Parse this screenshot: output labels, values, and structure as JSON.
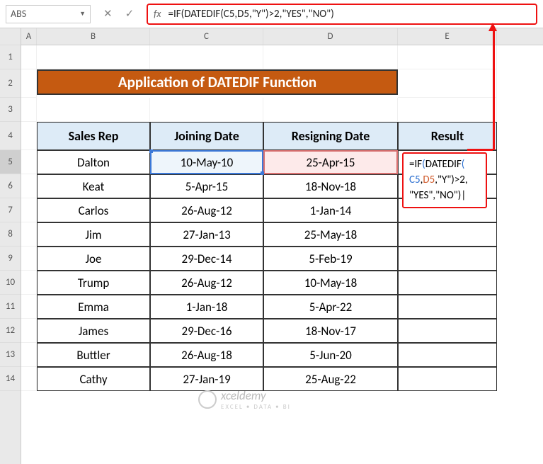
{
  "namebox": "ABS",
  "formula_bar": "=IF(DATEDIF(C5,D5,\"Y\")>2,\"YES\",\"NO\")",
  "fx_label": "fx",
  "col_headers": {
    "A": "A",
    "B": "B",
    "C": "C",
    "D": "D",
    "E": "E"
  },
  "row_headers": [
    "1",
    "2",
    "3",
    "4",
    "5",
    "6",
    "7",
    "8",
    "9",
    "10",
    "11",
    "12",
    "13",
    "14"
  ],
  "title": "Application of DATEDIF Function",
  "table": {
    "headers": {
      "b": "Sales Rep",
      "c": "Joining Date",
      "d": "Resigning Date",
      "e": "Result"
    },
    "rows": [
      {
        "b": "Dalton",
        "c": "10-May-10",
        "d": "25-Apr-15"
      },
      {
        "b": "Keat",
        "c": "5-Apr-15",
        "d": "18-Nov-18"
      },
      {
        "b": "Carlos",
        "c": "26-Aug-12",
        "d": "1-Jan-14"
      },
      {
        "b": "Jim",
        "c": "27-Jan-13",
        "d": "25-May-18"
      },
      {
        "b": "Joe",
        "c": "29-Dec-14",
        "d": "5-Feb-19"
      },
      {
        "b": "Trump",
        "c": "26-Aug-12",
        "d": "10-May-18"
      },
      {
        "b": "Emma",
        "c": "1-Jan-18",
        "d": "5-Apr-22"
      },
      {
        "b": "James",
        "c": "29-Dec-16",
        "d": "18-Nov-17"
      },
      {
        "b": "Buttler",
        "c": "26-Aug-18",
        "d": "5-Jun-20"
      },
      {
        "b": "Cathy",
        "c": "27-Jan-19",
        "d": "25-Aug-22"
      }
    ]
  },
  "overlay_formula": {
    "line1_a": "=IF",
    "line1_b": "(",
    "line1_c": "DATEDIF",
    "line1_d": "(",
    "line2_a": "C5",
    "line2_b": ",",
    "line2_c": "D5",
    "line2_d": ",\"Y\")>2,",
    "line3": "\"YES\",\"NO\")"
  },
  "watermark": {
    "brand": "xceldemy",
    "tagline": "EXCEL • DATA • BI"
  }
}
